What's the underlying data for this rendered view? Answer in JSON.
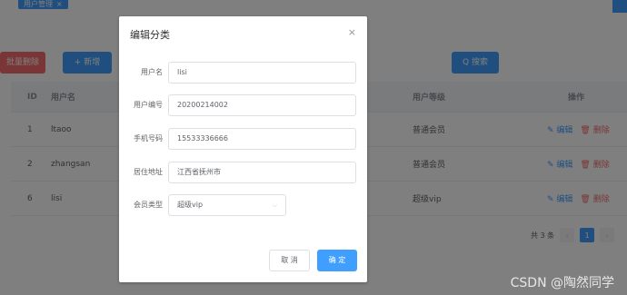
{
  "tabs": [
    {
      "label": "用户管理"
    }
  ],
  "toolbar": {
    "batch_delete_label": "批量删除",
    "add_label": "+ 新增",
    "search_label": "Q 搜索"
  },
  "table": {
    "headers": {
      "id": "ID",
      "username": "用户名",
      "level": "用户等级",
      "ops": "操作"
    },
    "rows": [
      {
        "id": "1",
        "username": "ltaoo",
        "level": "普通会员"
      },
      {
        "id": "2",
        "username": "zhangsan",
        "level": "普通会员"
      },
      {
        "id": "6",
        "username": "lisi",
        "level": "超级vip"
      }
    ],
    "edit_label": "编辑",
    "delete_label": "删除"
  },
  "pagination": {
    "total_label": "共 3 条",
    "current_page": "1"
  },
  "dialog": {
    "title": "编辑分类",
    "close_glyph": "×",
    "fields": [
      {
        "label": "用户名",
        "value": "lisi"
      },
      {
        "label": "用户编号",
        "value": "20200214002"
      },
      {
        "label": "手机号码",
        "value": "15533336666"
      },
      {
        "label": "居住地址",
        "value": "江西省抚州市"
      }
    ],
    "member_type": {
      "label": "会员类型",
      "value": "超级vip"
    },
    "cancel_label": "取 消",
    "ok_label": "确 定"
  },
  "watermark": "CSDN @陶然同学",
  "colors": {
    "primary": "#409eff",
    "danger": "#f56c6c",
    "overlay": "rgba(0,0,0,0.5)"
  }
}
